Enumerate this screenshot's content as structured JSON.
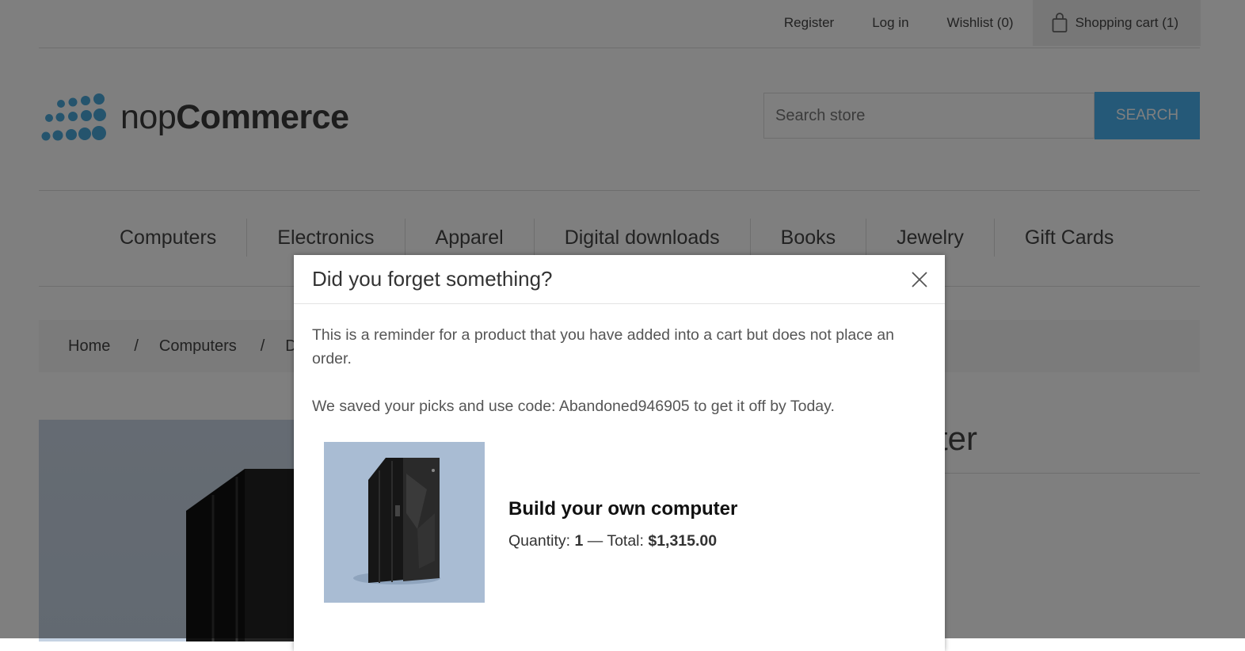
{
  "header": {
    "links": [
      "Register",
      "Log in",
      "Wishlist (0)"
    ],
    "cart": "Shopping cart (1)"
  },
  "logo": {
    "text_light": "nop",
    "text_bold": "Commerce"
  },
  "search": {
    "placeholder": "Search store",
    "button": "SEARCH"
  },
  "menu": [
    "Computers",
    "Electronics",
    "Apparel",
    "Digital downloads",
    "Books",
    "Jewelry",
    "Gift Cards"
  ],
  "breadcrumb": {
    "items": [
      "Home",
      "Computers",
      "De"
    ],
    "separator": "/"
  },
  "background_product": {
    "title_fragment": "ter"
  },
  "modal": {
    "title": "Did you forget something?",
    "message": "This is a reminder for a product that you have added into a cart but does not place an order.",
    "coupon_message": "We saved your picks and use code: Abandoned946905 to get it off by Today.",
    "product": {
      "name": "Build your own computer",
      "quantity_label": "Quantity:",
      "quantity": "1",
      "dash": "—",
      "total_label": "Total:",
      "total": "$1,315.00"
    }
  },
  "colors": {
    "accent": "#4ab2f1",
    "overlay": "rgba(0,0,0,0.5)"
  }
}
